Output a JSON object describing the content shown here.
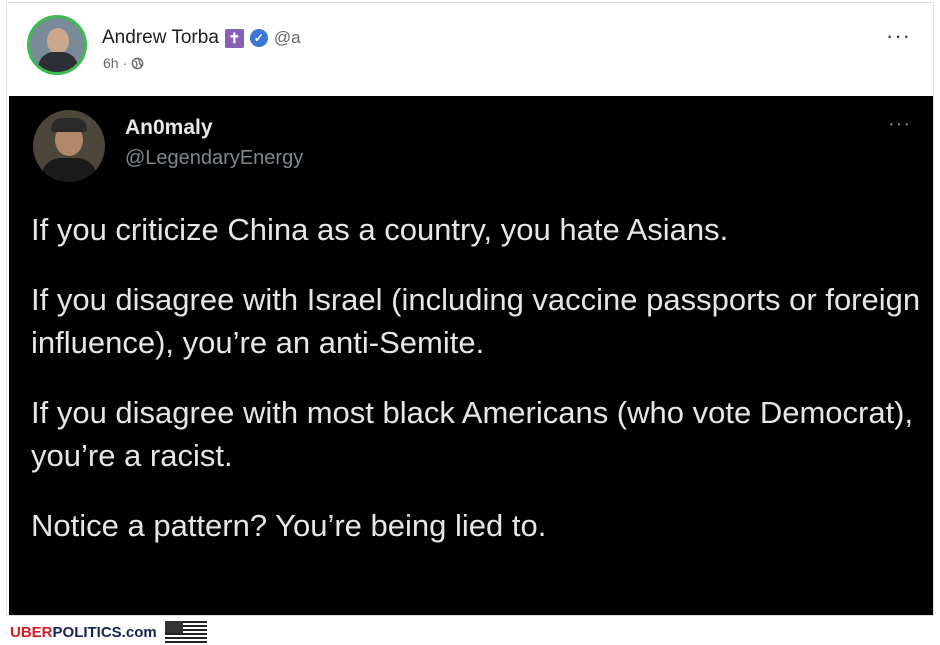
{
  "post": {
    "author_name": "Andrew Torba",
    "cross_symbol": "✝",
    "verified_symbol": "✓",
    "handle": "@a",
    "time": "6h",
    "separator": "·",
    "more_label": "···"
  },
  "embedded_tweet": {
    "name": "An0maly",
    "handle": "@LegendaryEnergy",
    "more_label": "···",
    "paragraphs": [
      "If you criticize China as a country, you hate Asians.",
      "If you disagree with Israel (including vaccine passports or foreign influence), you’re an anti-Semite.",
      "If you disagree with most black Americans (who vote Democrat), you’re a racist.",
      "Notice a pattern? You’re being lied to."
    ]
  },
  "footer": {
    "brand_red": "UBER",
    "brand_blue": "POLITICS.com"
  },
  "icons": {
    "globe": "globe-icon",
    "flag": "us-flag-icon",
    "verified": "verified-badge-icon",
    "more": "more-options-icon"
  },
  "colors": {
    "avatar_ring": "#3dbb4f",
    "verified": "#3a77d6",
    "cross_badge": "#8a5fb8",
    "embed_bg": "#000000",
    "footer_red": "#d11e26",
    "footer_blue": "#17234f"
  }
}
